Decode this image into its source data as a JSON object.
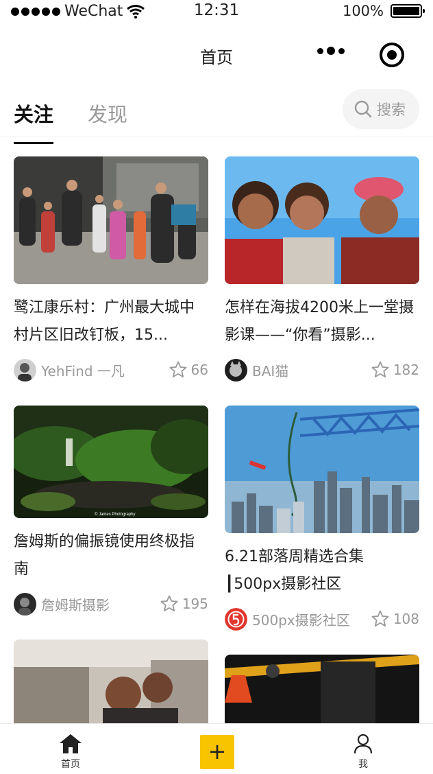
{
  "status_bar": {
    "carrier": "WeChat",
    "time": "12:31",
    "battery": "100%"
  },
  "navbar": {
    "title": "首页"
  },
  "tabs": {
    "active": "关注",
    "inactive": "发现",
    "search_label": "搜索"
  },
  "feed": {
    "left": [
      {
        "title": "鹭江康乐村：广州最大城中村片区旧改钉板，15...",
        "author": "YehFind 一凡",
        "likes": "66"
      },
      {
        "title": "詹姆斯的偏振镜使用终极指南",
        "author": "詹姆斯摄影",
        "likes": "195",
        "image_caption": "© James Photography"
      }
    ],
    "right": [
      {
        "title": "怎样在海拔4200米上一堂摄影课——“你看”摄影...",
        "author": "BAI猫",
        "likes": "182"
      },
      {
        "title": "6.21部落周精选合集 ┃500px摄影社区",
        "author": "500px摄影社区",
        "likes": "108"
      }
    ]
  },
  "tabbar": {
    "home_label": "首页",
    "add_label": "+",
    "me_label": "我"
  },
  "colors": {
    "accent": "#f8c400",
    "muted_text": "#999999"
  }
}
